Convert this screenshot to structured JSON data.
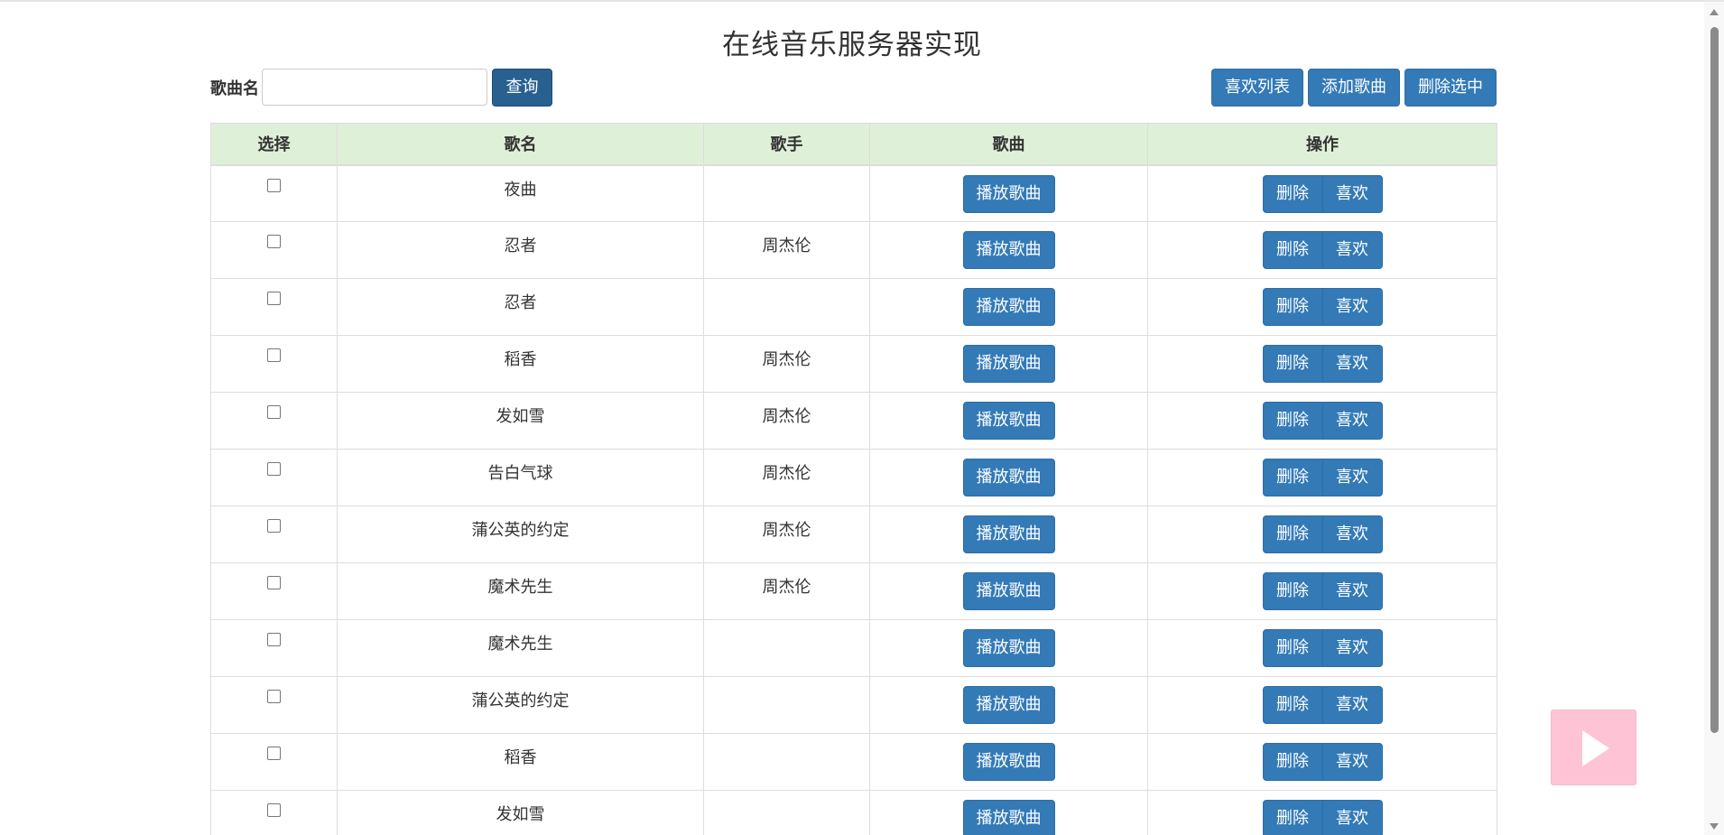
{
  "page": {
    "title": "在线音乐服务器实现"
  },
  "search": {
    "label": "歌曲名",
    "value": "",
    "placeholder": "",
    "button_label": "查询"
  },
  "toolbar": {
    "favorites_label": "喜欢列表",
    "add_label": "添加歌曲",
    "delete_selected_label": "删除选中"
  },
  "table": {
    "headers": [
      "选择",
      "歌名",
      "歌手",
      "歌曲",
      "操作"
    ],
    "play_label": "播放歌曲",
    "delete_label": "删除",
    "like_label": "喜欢",
    "rows": [
      {
        "title": "夜曲",
        "singer": "",
        "checked": false
      },
      {
        "title": "忍者",
        "singer": "周杰伦",
        "checked": false
      },
      {
        "title": "忍者",
        "singer": "",
        "checked": false
      },
      {
        "title": "稻香",
        "singer": "周杰伦",
        "checked": false
      },
      {
        "title": "发如雪",
        "singer": "周杰伦",
        "checked": false
      },
      {
        "title": "告白气球",
        "singer": "周杰伦",
        "checked": false
      },
      {
        "title": "蒲公英的约定",
        "singer": "周杰伦",
        "checked": false
      },
      {
        "title": "魔术先生",
        "singer": "周杰伦",
        "checked": false
      },
      {
        "title": "魔术先生",
        "singer": "",
        "checked": false
      },
      {
        "title": "蒲公英的约定",
        "singer": "",
        "checked": false
      },
      {
        "title": "稻香",
        "singer": "",
        "checked": false
      },
      {
        "title": "发如雪",
        "singer": "",
        "checked": false
      }
    ]
  },
  "player": {
    "icon": "play-icon",
    "color": "#fec4d6"
  },
  "colors": {
    "primary_button": "#337ab7",
    "header_background": "#dff0d8"
  }
}
